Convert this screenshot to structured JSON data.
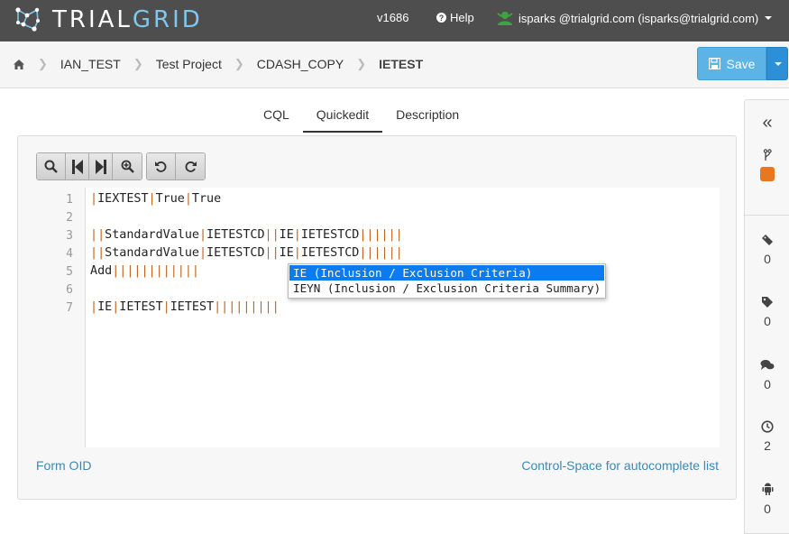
{
  "app": {
    "brand_trial": "TRIAL",
    "brand_grid": "GRID",
    "version": "v1686",
    "help": "Help",
    "user": "isparks @trialgrid.com (isparks@trialgrid.com)"
  },
  "breadcrumb": [
    "IAN_TEST",
    "Test Project",
    "CDASH_COPY",
    "IETEST"
  ],
  "save_label": "Save",
  "tabs": [
    "CQL",
    "Quickedit",
    "Description"
  ],
  "active_tab": "Quickedit",
  "editor": {
    "line_numbers": [
      "1",
      "2",
      "3",
      "4",
      "5",
      "6",
      "7"
    ],
    "lines": [
      "|IEXTEST|True|True",
      "",
      "||StandardValue|IETESTCD||IE|IETESTCD||||||",
      "||StandardValue|IETESTCD||IE|IETESTCD||||||",
      "Add||||||||||||",
      "",
      "|IE|IETEST|IETEST|||||||||"
    ]
  },
  "autocomplete": [
    "IE (Inclusion / Exclusion Criteria)",
    "IEYN (Inclusion / Exclusion Criteria Summary)"
  ],
  "footer": {
    "form_oid": "Form OID",
    "hint": "Control-Space for autocomplete list"
  },
  "sidebar": {
    "counts": {
      "versions": "0",
      "tags": "0",
      "comments": "0",
      "history": "2",
      "android": "0"
    },
    "status_color": "#e87722"
  },
  "colors": {
    "navbar": "#4e4e4e",
    "accent": "#5bb3e6",
    "pipe": "#c0641e",
    "link": "#3a8ab8"
  }
}
